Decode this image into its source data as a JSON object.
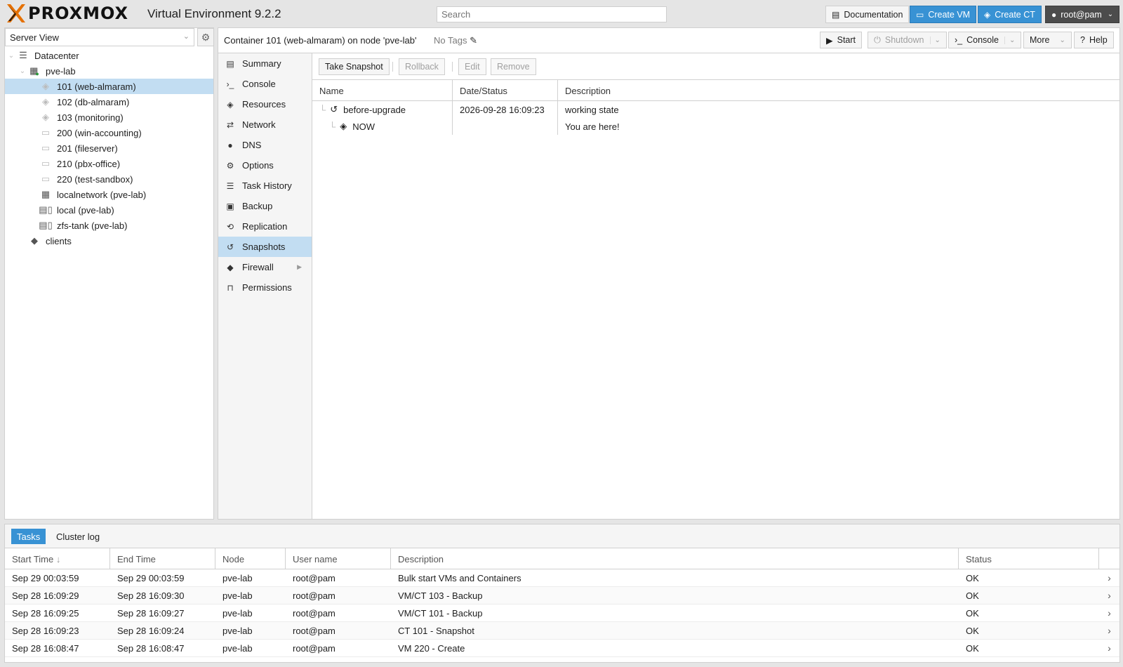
{
  "header": {
    "logo_text": "PROXMOX",
    "product": "Virtual Environment 9.2.2",
    "search_placeholder": "Search",
    "documentation": "Documentation",
    "create_vm": "Create VM",
    "create_ct": "Create CT",
    "user": "root@pam"
  },
  "leftpanel": {
    "view": "Server View",
    "tree": [
      {
        "label": "Datacenter",
        "icon": "datacenter-icon",
        "level": 0
      },
      {
        "label": "pve-lab",
        "icon": "node-icon",
        "level": 1
      },
      {
        "label": "101 (web-almaram)",
        "icon": "container-icon",
        "level": 2,
        "selected": true
      },
      {
        "label": "102 (db-almaram)",
        "icon": "container-icon",
        "level": 2
      },
      {
        "label": "103 (monitoring)",
        "icon": "container-icon",
        "level": 2
      },
      {
        "label": "200 (win-accounting)",
        "icon": "vm-icon",
        "level": 2
      },
      {
        "label": "201 (fileserver)",
        "icon": "vm-icon",
        "level": 2
      },
      {
        "label": "210 (pbx-office)",
        "icon": "vm-icon",
        "level": 2
      },
      {
        "label": "220 (test-sandbox)",
        "icon": "vm-icon",
        "level": 2
      },
      {
        "label": "localnetwork (pve-lab)",
        "icon": "network-grid-icon",
        "level": 2
      },
      {
        "label": "local (pve-lab)",
        "icon": "storage-icon",
        "level": 2
      },
      {
        "label": "zfs-tank (pve-lab)",
        "icon": "storage-icon",
        "level": 2
      },
      {
        "label": "clients",
        "icon": "tags-icon",
        "level": 1
      }
    ]
  },
  "content": {
    "title": "Container 101 (web-almaram) on node 'pve-lab'",
    "tags": "No Tags",
    "start": "Start",
    "shutdown": "Shutdown",
    "console": "Console",
    "more": "More",
    "help": "Help"
  },
  "nav": [
    {
      "label": "Summary",
      "icon": "book-icon",
      "glyph": "▤"
    },
    {
      "label": "Console",
      "icon": "terminal-icon",
      "glyph": "›_"
    },
    {
      "label": "Resources",
      "icon": "cube-icon",
      "glyph": "◈"
    },
    {
      "label": "Network",
      "icon": "exchange-icon",
      "glyph": "⇄"
    },
    {
      "label": "DNS",
      "icon": "globe-icon",
      "glyph": "●"
    },
    {
      "label": "Options",
      "icon": "gear-icon",
      "glyph": "⚙"
    },
    {
      "label": "Task History",
      "icon": "list-icon",
      "glyph": "☰"
    },
    {
      "label": "Backup",
      "icon": "floppy-icon",
      "glyph": "▣"
    },
    {
      "label": "Replication",
      "icon": "retweet-icon",
      "glyph": "⟲"
    },
    {
      "label": "Snapshots",
      "icon": "history-icon",
      "glyph": "↺",
      "active": true
    },
    {
      "label": "Firewall",
      "icon": "shield-icon",
      "glyph": "◆",
      "submenu": true
    },
    {
      "label": "Permissions",
      "icon": "unlock-icon",
      "glyph": "🔓"
    }
  ],
  "snapshots": {
    "toolbar": {
      "take": "Take Snapshot",
      "rollback": "Rollback",
      "edit": "Edit",
      "remove": "Remove"
    },
    "columns": {
      "name": "Name",
      "date": "Date/Status",
      "desc": "Description"
    },
    "rows": [
      {
        "name": "before-upgrade",
        "date": "2026-09-28 16:09:23",
        "desc": "working state"
      },
      {
        "name": "NOW",
        "date": "",
        "desc": "You are here!"
      }
    ]
  },
  "tasks": {
    "tabs": {
      "tasks": "Tasks",
      "cluster_log": "Cluster log"
    },
    "columns": {
      "start": "Start Time",
      "end": "End Time",
      "node": "Node",
      "user": "User name",
      "desc": "Description",
      "status": "Status"
    },
    "rows": [
      {
        "start": "Sep 29 00:03:59",
        "end": "Sep 29 00:03:59",
        "node": "pve-lab",
        "user": "root@pam",
        "desc": "Bulk start VMs and Containers",
        "status": "OK"
      },
      {
        "start": "Sep 28 16:09:29",
        "end": "Sep 28 16:09:30",
        "node": "pve-lab",
        "user": "root@pam",
        "desc": "VM/CT 103 - Backup",
        "status": "OK"
      },
      {
        "start": "Sep 28 16:09:25",
        "end": "Sep 28 16:09:27",
        "node": "pve-lab",
        "user": "root@pam",
        "desc": "VM/CT 101 - Backup",
        "status": "OK"
      },
      {
        "start": "Sep 28 16:09:23",
        "end": "Sep 28 16:09:24",
        "node": "pve-lab",
        "user": "root@pam",
        "desc": "CT 101 - Snapshot",
        "status": "OK"
      },
      {
        "start": "Sep 28 16:08:47",
        "end": "Sep 28 16:08:47",
        "node": "pve-lab",
        "user": "root@pam",
        "desc": "VM 220 - Create",
        "status": "OK"
      }
    ]
  },
  "colors": {
    "accent": "#3892d4",
    "selection": "#c2ddf2",
    "logo_orange": "#e57000"
  }
}
